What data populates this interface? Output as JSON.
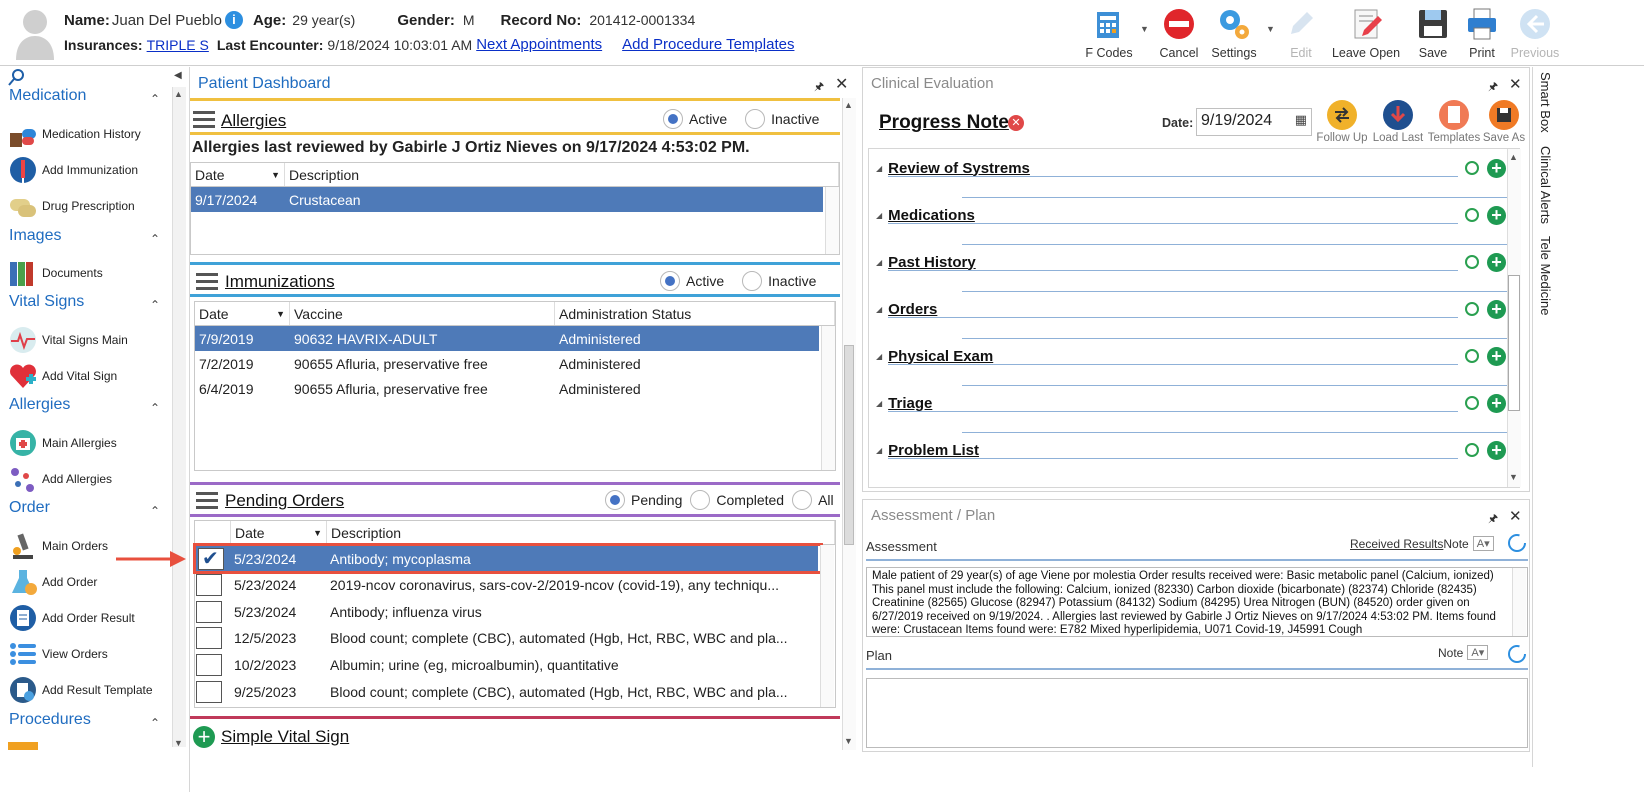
{
  "patient": {
    "name_label": "Name:",
    "name": "Juan Del Pueblo",
    "age_label": "Age:",
    "age": "29 year(s)",
    "gender_label": "Gender:",
    "gender": "M",
    "record_label": "Record No:",
    "record": "201412-0001334",
    "insurances_label": "Insurances:",
    "insurance": "TRIPLE S",
    "last_encounter_label": "Last Encounter:",
    "last_encounter": "9/18/2024 10:03:01 AM",
    "next_appointments": "Next Appointments",
    "add_procedure_templates": "Add Procedure Templates"
  },
  "toolbar": {
    "fcodes": "F Codes",
    "cancel": "Cancel",
    "settings": "Settings",
    "edit": "Edit",
    "leave_open": "Leave Open",
    "save": "Save",
    "print": "Print",
    "previous": "Previous"
  },
  "sidebar": {
    "medication": {
      "title": "Medication",
      "items": [
        "Medication History",
        "Add Immunization",
        "Drug Prescription"
      ]
    },
    "images": {
      "title": "Images",
      "items": [
        "Documents"
      ]
    },
    "vital_signs": {
      "title": "Vital Signs",
      "items": [
        "Vital Signs Main",
        "Add Vital Sign"
      ]
    },
    "allergies": {
      "title": "Allergies",
      "items": [
        "Main Allergies",
        "Add Allergies"
      ]
    },
    "order": {
      "title": "Order",
      "items": [
        "Main Orders",
        "Add Order",
        "Add Order Result",
        "View Orders",
        "Add Result Template"
      ]
    },
    "procedures": {
      "title": "Procedures"
    }
  },
  "dashboard": {
    "title": "Patient Dashboard",
    "allergies": {
      "title": "Allergies",
      "active": "Active",
      "inactive": "Inactive",
      "reviewed": "Allergies last reviewed by Gabirle J Ortiz Nieves on 9/17/2024 4:53:02 PM.",
      "headers": [
        "Date",
        "Description"
      ],
      "rows": [
        [
          "9/17/2024",
          "Crustacean"
        ]
      ]
    },
    "immunizations": {
      "title": "Immunizations",
      "active": "Active",
      "inactive": "Inactive",
      "headers": [
        "Date",
        "Vaccine",
        "Administration Status"
      ],
      "rows": [
        [
          "7/9/2019",
          "90632 HAVRIX-ADULT",
          "Administered"
        ],
        [
          "7/2/2019",
          "90655 Afluria, preservative free",
          "Administered"
        ],
        [
          "6/4/2019",
          "90655 Afluria, preservative free",
          "Administered"
        ]
      ]
    },
    "pending_orders": {
      "title": "Pending Orders",
      "pending": "Pending",
      "completed": "Completed",
      "all": "All",
      "headers": [
        "Date",
        "Description"
      ],
      "rows": [
        [
          "5/23/2024",
          "Antibody; mycoplasma"
        ],
        [
          "5/23/2024",
          "2019-ncov coronavirus, sars-cov-2/2019-ncov (covid-19), any techniqu..."
        ],
        [
          "5/23/2024",
          "Antibody; influenza virus"
        ],
        [
          "12/5/2023",
          "Blood count; complete (CBC), automated (Hgb, Hct, RBC, WBC and pla..."
        ],
        [
          "10/2/2023",
          "Albumin; urine (eg, microalbumin), quantitative"
        ],
        [
          "9/25/2023",
          "Blood count; complete (CBC), automated (Hgb, Hct, RBC, WBC and pla..."
        ]
      ]
    },
    "simple_vital_sign": "Simple Vital Sign"
  },
  "clinical": {
    "title": "Clinical Evaluation",
    "progress_note": "Progress Note",
    "date_label": "Date:",
    "date": "9/19/2024",
    "buttons": [
      "Follow Up",
      "Load Last",
      "Templates",
      "Save As"
    ],
    "sections": [
      "Review of Systrems",
      "Medications",
      "Past History",
      "Orders",
      "Physical Exam",
      "Triage",
      "Problem List"
    ]
  },
  "assessment": {
    "title": "Assessment / Plan",
    "assessment_label": "Assessment",
    "received_results": "Received Results",
    "note": "Note",
    "text": "Male patient of 29 year(s) of age Viene por molestia   Order results received were: Basic metabolic panel (Calcium, ionized) This panel must include the following: Calcium, ionized (82330) Carbon dioxide (bicarbonate) (82374) Chloride (82435) Creatinine (82565) Glucose (82947) Potassium (84132) Sodium (84295) Urea Nitrogen (BUN) (84520) order given on 6/27/2019 received on 9/19/2024. .  Allergies last reviewed by Gabirle J Ortiz Nieves on 9/17/2024 4:53:02 PM.    Items found were:  Crustacean  Items found were:  E782 Mixed hyperlipidemia, U071 Covid-19, J45991 Cough",
    "plan_label": "Plan",
    "plan_note": "Note"
  },
  "side_tabs": [
    "Smart Box",
    "Clinical Alerts",
    "Tele Medicine"
  ]
}
